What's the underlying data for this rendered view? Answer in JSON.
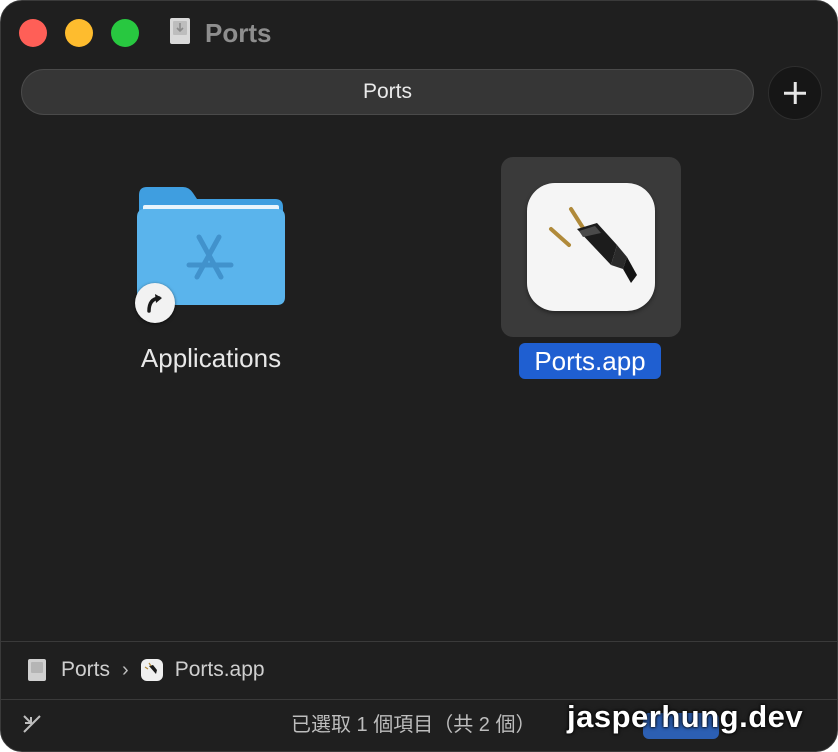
{
  "window": {
    "title": "Ports",
    "tab_title": "Ports"
  },
  "items": [
    {
      "name": "Applications",
      "selected": false,
      "alias": true
    },
    {
      "name": "Ports.app",
      "selected": true,
      "alias": false
    }
  ],
  "breadcrumb": {
    "parts": [
      "Ports",
      "Ports.app"
    ],
    "separator": "›"
  },
  "status": {
    "text": "已選取 1 個項目（共 2 個）"
  },
  "watermark": "jasperhung.dev",
  "colors": {
    "window_bg": "#1f1f1f",
    "selection": "#1f5fd1",
    "close": "#ff5f57",
    "minimize": "#febc2e",
    "zoom": "#28c840",
    "folder": "#5ab4ec"
  },
  "icons": [
    "disk-icon",
    "folder-icon",
    "alias-arrow-icon",
    "plug-app-icon",
    "add-icon",
    "collapse-icon"
  ]
}
